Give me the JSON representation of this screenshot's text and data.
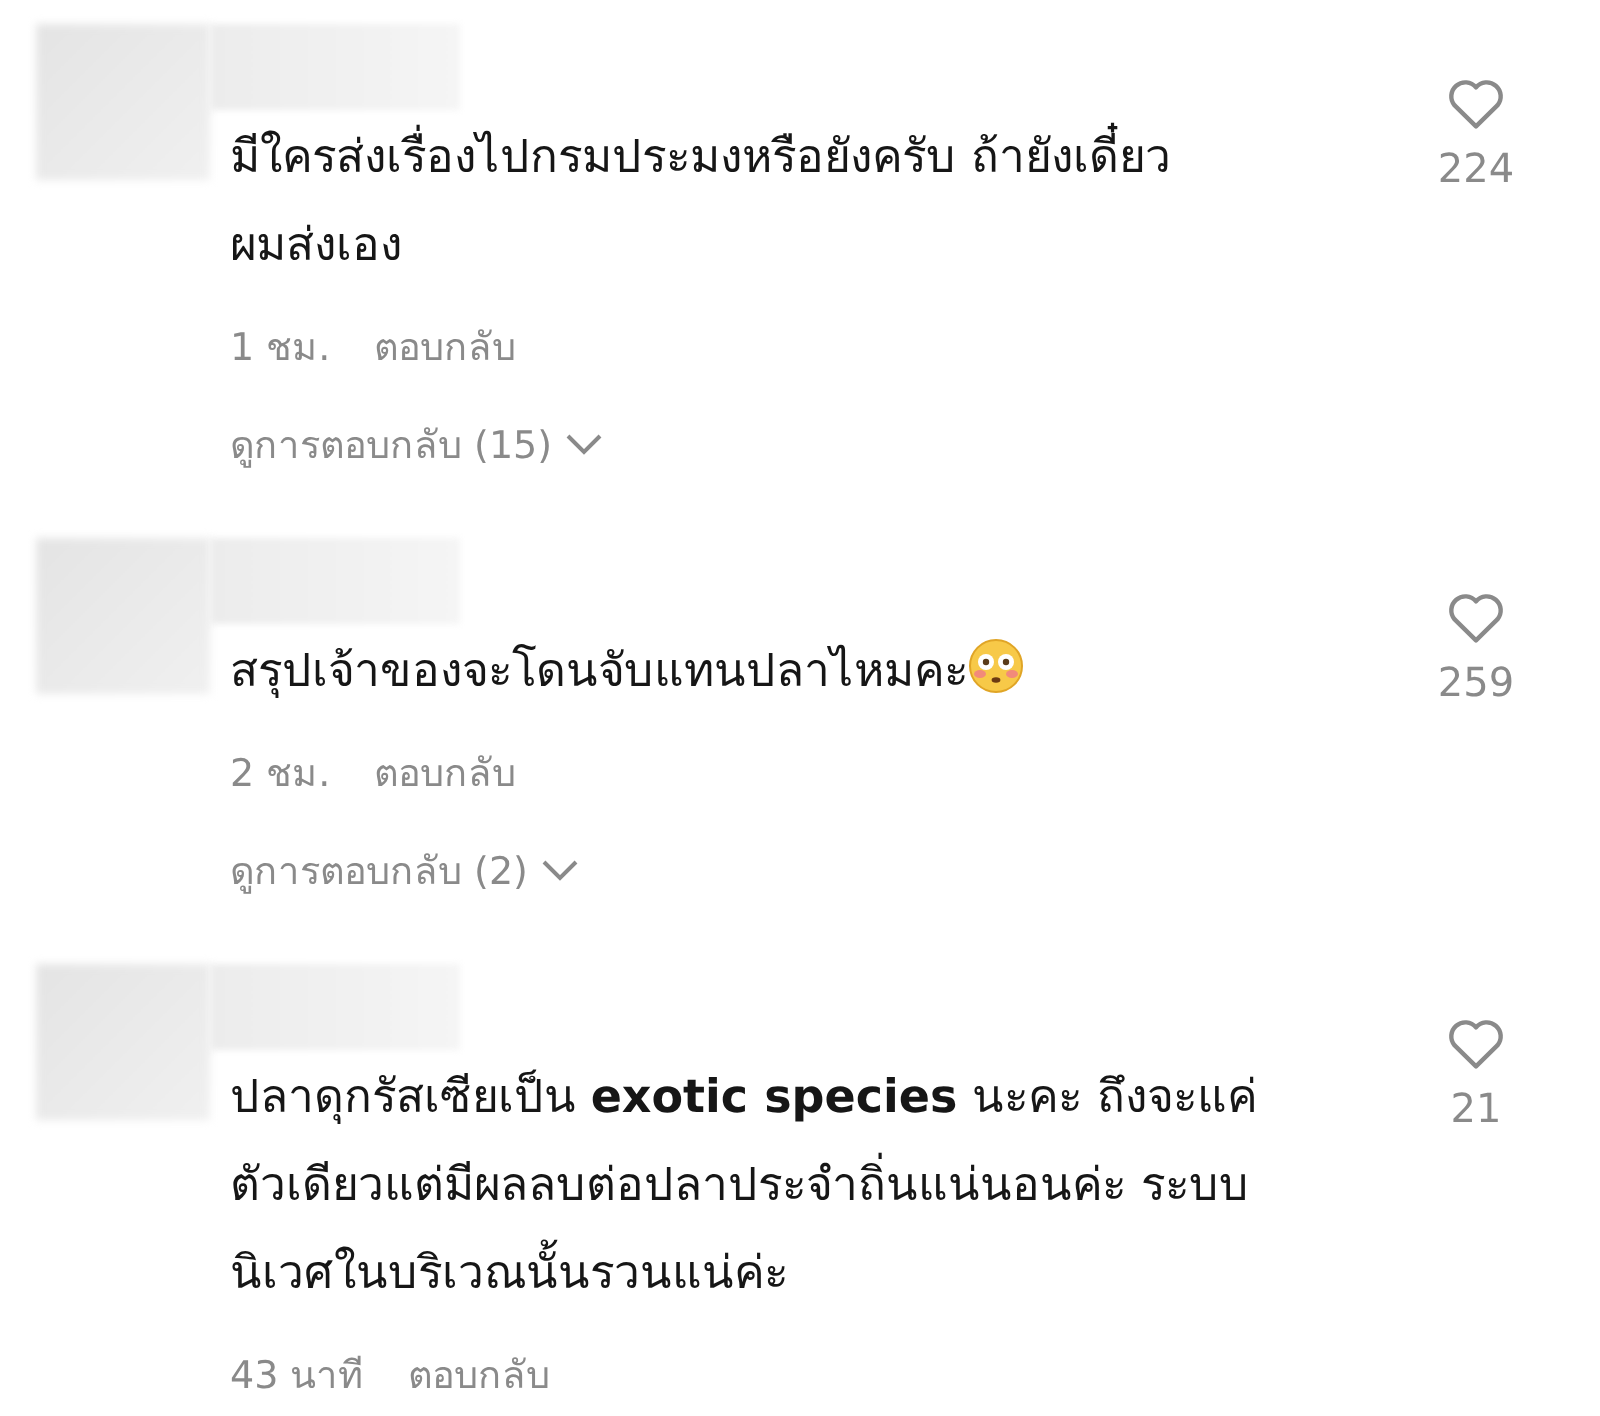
{
  "comments": [
    {
      "lines": [
        "มีใครส่งเรื่องไปกรมประมงหรือยังครับ ถ้ายังเดี๋ยว",
        "ผมส่งเอง"
      ],
      "emoji": false,
      "time": "1 ชม.",
      "reply": "ตอบกลับ",
      "likes": "224",
      "view_replies": "ดูการตอบกลับ (15)"
    },
    {
      "lines": [
        "สรุปเจ้าของจะโดนจับแทนปลาไหมคะ"
      ],
      "emoji": true,
      "time": "2 ชม.",
      "reply": "ตอบกลับ",
      "likes": "259",
      "view_replies": "ดูการตอบกลับ (2)"
    },
    {
      "lines": [
        "ปลาดุกรัสเซียเป็น **exotic species** นะคะ ถึงจะแค่",
        "ตัวเดียวแต่มีผลลบต่อปลาประจำถิ่นแน่นอนค่ะ ระบบ",
        "นิเวศในบริเวณนั้นรวนแน่ค่ะ"
      ],
      "emoji": false,
      "time": "43 นาที",
      "reply": "ตอบกลับ",
      "likes": "21"
    }
  ]
}
